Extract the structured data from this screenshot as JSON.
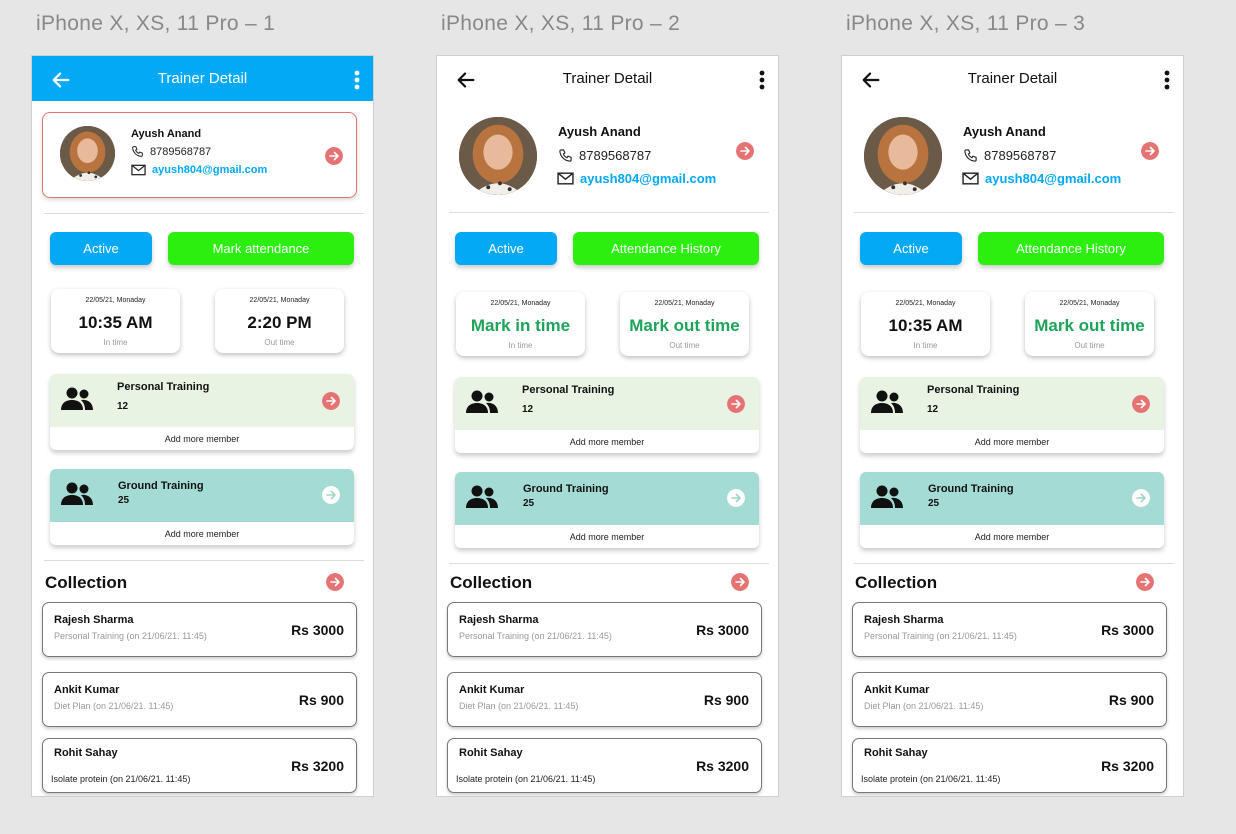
{
  "frames": [
    {
      "label": "iPhone X, XS, 11 Pro – 1",
      "header_title": "Trainer Detail",
      "profile": {
        "name": "Ayush Anand",
        "phone": "8789568787",
        "email": "ayush804@gmail.com"
      },
      "buttons": {
        "status": "Active",
        "action": "Mark attendance"
      },
      "in_card": {
        "date": "22/05/21, Monaday",
        "value": "10:35 AM",
        "sub": "In time"
      },
      "out_card": {
        "date": "22/05/21, Monaday",
        "value": "2:20 PM",
        "sub": "Out time"
      },
      "personal": {
        "name": "Personal Training",
        "count": "12",
        "footer": "Add more member"
      },
      "ground": {
        "name": "Ground Training",
        "count": "25",
        "footer": "Add more member"
      },
      "collection_title": "Collection",
      "collections": [
        {
          "name": "Rajesh Sharma",
          "desc": "Personal Training (on 21/06/21. 11:45)",
          "amount": "Rs 3000"
        },
        {
          "name": "Ankit Kumar",
          "desc": "Diet Plan (on 21/06/21. 11:45)",
          "amount": "Rs 900"
        },
        {
          "name": "Rohit Sahay",
          "desc": "Isolate protein (on 21/06/21. 11:45)",
          "amount": "Rs 3200"
        }
      ]
    },
    {
      "label": "iPhone X, XS, 11 Pro – 2",
      "header_title": "Trainer Detail",
      "profile": {
        "name": "Ayush Anand",
        "phone": "8789568787",
        "email": "ayush804@gmail.com"
      },
      "buttons": {
        "status": "Active",
        "action": "Attendance History"
      },
      "in_card": {
        "date": "22/05/21, Monaday",
        "value": "Mark in time",
        "sub": "In time"
      },
      "out_card": {
        "date": "22/05/21, Monaday",
        "value": "Mark out time",
        "sub": "Out time"
      },
      "personal": {
        "name": "Personal Training",
        "count": "12",
        "footer": "Add more member"
      },
      "ground": {
        "name": "Ground Training",
        "count": "25",
        "footer": "Add more member"
      },
      "collection_title": "Collection",
      "collections": [
        {
          "name": "Rajesh Sharma",
          "desc": "Personal Training (on 21/06/21. 11:45)",
          "amount": "Rs 3000"
        },
        {
          "name": "Ankit Kumar",
          "desc": "Diet Plan (on 21/06/21. 11:45)",
          "amount": "Rs 900"
        },
        {
          "name": "Rohit Sahay",
          "desc": "Isolate protein (on 21/06/21. 11:45)",
          "amount": "Rs 3200"
        }
      ]
    },
    {
      "label": "iPhone X, XS, 11 Pro – 3",
      "header_title": "Trainer Detail",
      "profile": {
        "name": "Ayush Anand",
        "phone": "8789568787",
        "email": "ayush804@gmail.com"
      },
      "buttons": {
        "status": "Active",
        "action": "Attendance History"
      },
      "in_card": {
        "date": "22/05/21, Monaday",
        "value": "10:35 AM",
        "sub": "In time"
      },
      "out_card": {
        "date": "22/05/21, Monaday",
        "value": "Mark out time",
        "sub": "Out time"
      },
      "personal": {
        "name": "Personal Training",
        "count": "12",
        "footer": "Add more member"
      },
      "ground": {
        "name": "Ground Training",
        "count": "25",
        "footer": "Add more member"
      },
      "collection_title": "Collection",
      "collections": [
        {
          "name": "Rajesh Sharma",
          "desc": "Personal Training (on 21/06/21. 11:45)",
          "amount": "Rs 3000"
        },
        {
          "name": "Ankit Kumar",
          "desc": "Diet Plan (on 21/06/21. 11:45)",
          "amount": "Rs 900"
        },
        {
          "name": "Rohit Sahay",
          "desc": "Isolate protein (on 21/06/21. 11:45)",
          "amount": "Rs 3200"
        }
      ]
    }
  ],
  "colors": {
    "header_blue": "#03a9f4",
    "active_button": "#03a9f4",
    "green_button": "#2cef10",
    "red_accent": "#e57373",
    "personal_card_bg": "#e8f3e3",
    "ground_card_bg": "#a4dcd5",
    "mark_time_green": "#1fa35a"
  },
  "icons": [
    "back-arrow-icon",
    "more-vertical-icon",
    "phone-icon",
    "mail-icon",
    "arrow-right-circle-icon",
    "people-icon"
  ]
}
